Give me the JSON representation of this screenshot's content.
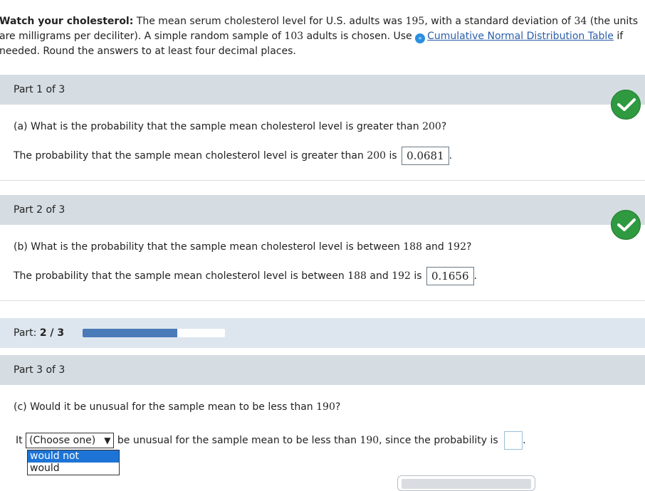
{
  "intro": {
    "title": "Watch your cholesterol:",
    "line1_text": " The mean serum cholesterol level for U.S. adults was ",
    "mean": "195",
    "line1_mid": ", with a standard deviation of ",
    "sd": "34",
    "line1_end": " (the units",
    "line2_text": "are milligrams per deciliter). A simple random sample of ",
    "n": "103",
    "line2_mid": " adults is chosen. Use ",
    "table_link": "Cumulative Normal Distribution Table",
    "line2_end": " if",
    "line3_text": "needed. Round the answers to at least four decimal places."
  },
  "part1": {
    "label": "Part 1 of 3",
    "question": "(a) What is the probability that the sample mean cholesterol level is greater than ",
    "question_value": "200",
    "question_end": "?",
    "answer_prefix": "The probability that the sample mean cholesterol level is greater than ",
    "answer_value_ref": "200",
    "answer_is": " is ",
    "answer": "0.0681",
    "answer_end": "."
  },
  "part2": {
    "label": "Part 2 of 3",
    "question": "(b) What is the probability that the sample mean cholesterol level is between ",
    "q_low": "188",
    "q_and": " and ",
    "q_high": "192",
    "question_end": "?",
    "answer_prefix": "The probability that the sample mean cholesterol level is between ",
    "a_low": "188",
    "a_and": " and ",
    "a_high": "192",
    "answer_is": " is ",
    "answer": "0.1656",
    "answer_end": "."
  },
  "progress": {
    "label": "Part:",
    "value_text": "2 / 3",
    "fraction": 0.6667
  },
  "part3": {
    "label": "Part 3 of 3",
    "question": "(c) Would it be unusual for the sample mean to be less than ",
    "q_value": "190",
    "question_end": "?",
    "it": "It",
    "select_value": "(Choose one)",
    "sentence": " be unusual for the sample mean to be less than ",
    "s_value": "190",
    "sentence_end": ", since the probability is ",
    "period": ".",
    "options": [
      "would not",
      "would"
    ]
  },
  "colors": {
    "check": "#2f9a3f",
    "progress_fill": "#4a7ab8",
    "option_selected": "#1e74d6"
  },
  "icons": {
    "check": "check-icon",
    "info": "info-expand-icon",
    "dropdown": "triangle-down-icon"
  }
}
